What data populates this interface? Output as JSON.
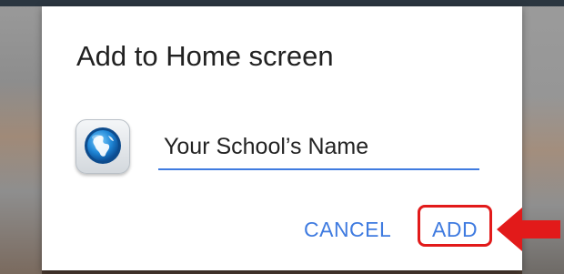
{
  "dialog": {
    "title": "Add to Home screen",
    "app_icon": "globe-icon",
    "name_field": {
      "value": "Your School’s Name"
    },
    "cancel_label": "CANCEL",
    "add_label": "ADD"
  },
  "annotation": {
    "highlight_color": "#e21a1a",
    "pointer_icon": "left-arrow-icon"
  },
  "colors": {
    "accent": "#3f7be0",
    "title_text": "#212121"
  }
}
